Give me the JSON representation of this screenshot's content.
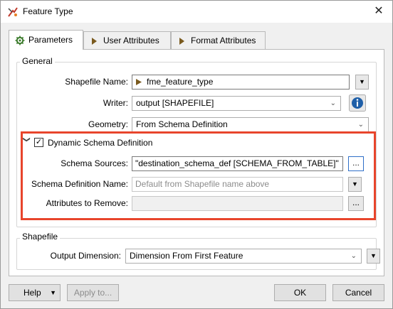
{
  "window": {
    "title": "Feature Type",
    "close_glyph": "✕"
  },
  "tabs": [
    {
      "label": "Parameters",
      "icon": "gear-icon"
    },
    {
      "label": "User Attributes",
      "icon": "attribute-arrow-icon"
    },
    {
      "label": "Format Attributes",
      "icon": "attribute-arrow-icon"
    }
  ],
  "general": {
    "title": "General",
    "shapefile_name": {
      "label": "Shapefile Name:",
      "value": "fme_feature_type"
    },
    "writer": {
      "label": "Writer:",
      "value": "output [SHAPEFILE]"
    },
    "geometry": {
      "label": "Geometry:",
      "value": "From Schema Definition"
    },
    "dynamic": {
      "label": "Dynamic Schema Definition",
      "checked": true,
      "check_glyph": "✓",
      "expand_glyph": "❯",
      "schema_sources": {
        "label": "Schema Sources:",
        "value": "\"destination_schema_def [SCHEMA_FROM_TABLE]\""
      },
      "schema_def_name": {
        "label": "Schema Definition Name:",
        "placeholder": "Default from Shapefile name above"
      },
      "attrs_to_remove": {
        "label": "Attributes to Remove:",
        "value": ""
      },
      "ellipsis": "..."
    }
  },
  "shapefile": {
    "title": "Shapefile",
    "output_dimension": {
      "label": "Output Dimension:",
      "value": "Dimension From First Feature"
    }
  },
  "buttons": {
    "help": "Help",
    "apply": "Apply to...",
    "ok": "OK",
    "cancel": "Cancel",
    "dropdown_glyph": "▼",
    "combo_glyph": "⌄"
  },
  "colors": {
    "highlight": "#e8452c",
    "info_button": "#1f5fa8"
  }
}
